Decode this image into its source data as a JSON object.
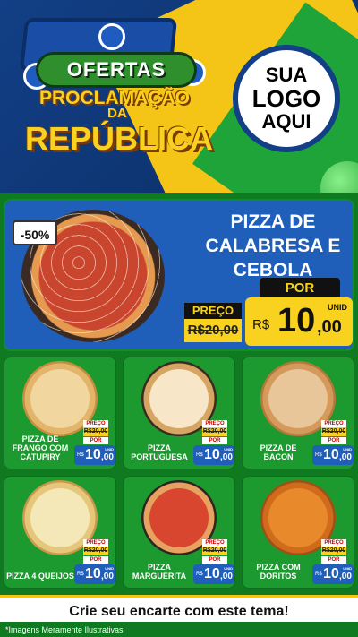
{
  "header": {
    "title_ofertas": "OFERTAS",
    "title_proclamacao": "PROCLAMAÇÃO",
    "title_da": "DA",
    "title_republica": "REPÚBLICA",
    "logo_line1": "SUA",
    "logo_line2": "LOGO",
    "logo_line3": "AQUI"
  },
  "hero": {
    "discount": "-50%",
    "name": "PIZZA DE CALABRESA E CEBOLA",
    "por_label": "POR",
    "preco_label": "PREÇO",
    "old_price": "R$20,00",
    "currency": "R$",
    "price_int": "10",
    "price_dec": ",00",
    "unit": "UNID"
  },
  "products": [
    {
      "name": "PIZZA DE FRANGO COM CATUPIRY",
      "preco_label": "PREÇO",
      "old_price": "R$20,00",
      "por_label": "POR",
      "currency": "R$",
      "price_int": "10",
      "price_dec": ",00",
      "unit": "UNID"
    },
    {
      "name": "PIZZA PORTUGUESA",
      "preco_label": "PREÇO",
      "old_price": "R$20,00",
      "por_label": "POR",
      "currency": "R$",
      "price_int": "10",
      "price_dec": ",00",
      "unit": "UNID"
    },
    {
      "name": "PIZZA DE BACON",
      "preco_label": "PREÇO",
      "old_price": "R$20,00",
      "por_label": "POR",
      "currency": "R$",
      "price_int": "10",
      "price_dec": ",00",
      "unit": "UNID"
    },
    {
      "name": "PIZZA 4 QUEIJOS",
      "preco_label": "PREÇO",
      "old_price": "R$20,00",
      "por_label": "POR",
      "currency": "R$",
      "price_int": "10",
      "price_dec": ",00",
      "unit": "UNID"
    },
    {
      "name": "PIZZA MARGUERITA",
      "preco_label": "PREÇO",
      "old_price": "R$20,00",
      "por_label": "POR",
      "currency": "R$",
      "price_int": "10",
      "price_dec": ",00",
      "unit": "UNID"
    },
    {
      "name": "PIZZA COM DORITOS",
      "preco_label": "PREÇO",
      "old_price": "R$20,00",
      "por_label": "POR",
      "currency": "R$",
      "price_int": "10",
      "price_dec": ",00",
      "unit": "UNID"
    }
  ],
  "footer": {
    "cta": "Crie seu encarte com este tema!",
    "disclaimer": "*Imagens Meramente Ilustrativas"
  },
  "colors": {
    "blue": "#1f5fba",
    "yellow": "#f9d21f",
    "green": "#1c9a2f"
  }
}
